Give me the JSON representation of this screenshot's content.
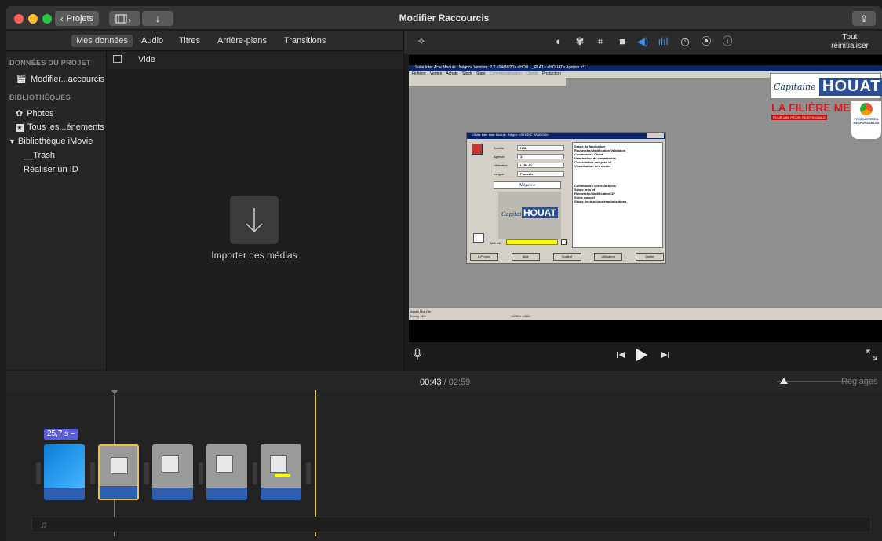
{
  "window": {
    "title": "Modifier Raccourcis",
    "projects_button": "Projets"
  },
  "browser": {
    "tabs": [
      "Mes données",
      "Audio",
      "Titres",
      "Arrière-plans",
      "Transitions"
    ],
    "active_tab": "Mes données",
    "filter_label": "Vide"
  },
  "sidebar": {
    "project_header": "DONNÉES DU PROJET",
    "project_item": "Modifier...accourcis",
    "libraries_header": "BIBLIOTHÈQUES",
    "items": [
      "Photos",
      "Tous les...énements",
      "Bibliothèque iMovie",
      "__Trash",
      "Réaliser un ID"
    ]
  },
  "media": {
    "import_label": "Importer des médias"
  },
  "viewer": {
    "reset_label": "Tout réinitialiser",
    "tools": [
      "magic-wand-icon",
      "color-balance-icon",
      "color-correction-icon",
      "crop-icon",
      "stabilization-icon",
      "volume-icon",
      "noise-reduction-icon",
      "speed-icon",
      "filter-icon",
      "info-icon"
    ]
  },
  "timeline": {
    "current_time": "00:43",
    "separator": "/",
    "total_time": "02:59",
    "settings_label": "Réglages",
    "first_clip_duration": "25,7 s –",
    "zoom_level": 0.1
  },
  "app_screen": {
    "window_title": "Suite Inter Acte Module : Négoce   Version : 7.2  <04/08/20>  <HOU L_RLA1>  <HOUAT>  Agence n°1",
    "menu": [
      "Fichiers",
      "Ventes",
      "Achats",
      "Stock",
      "Stats",
      "Commercialisation",
      "Clients",
      "Production"
    ],
    "logo_text": "HOUAT",
    "logo_script": "Capitaine",
    "banner_title": "LA FILIÈRE MER",
    "banner_sub": "POUR UNE PÊCHE RESPONSABLE",
    "banner_badge": "PRODUCTEURS RESPONSABLES",
    "dialog": {
      "title": "<Suite Inter Acte Module : Négo>  <SYNDIC WINDOW>",
      "fields": [
        {
          "label": "Société",
          "value": "HOU"
        },
        {
          "label": "Agence",
          "value": "1"
        },
        {
          "label": "Utilisateur",
          "value": "L_RLA1"
        },
        {
          "label": "Langue",
          "value": "Francais"
        }
      ],
      "module_button": "Négoce",
      "password_label": "Mot clé",
      "menu_group1": [
        "Saisie de fabrication",
        "Recherche/Modification/Validation",
        "Commandes Client",
        "Valorisation de commandes",
        "Consultation des prés of",
        "Visualisation des stocks"
      ],
      "menu_group2": [
        "Commandes clients/articles",
        "Saisie prés of",
        "Recherche/Modification OF",
        "Solde manuel",
        "Saisie destructions/regularisations"
      ],
      "buttons": [
        "A Propos",
        "Aide",
        "Société",
        "Utilisateur",
        "Quitter"
      ]
    },
    "status_line1": "Accès Mot Clé",
    "status_line2": "Enreg : 1/1",
    "status_center": "<DSC> <080>"
  }
}
